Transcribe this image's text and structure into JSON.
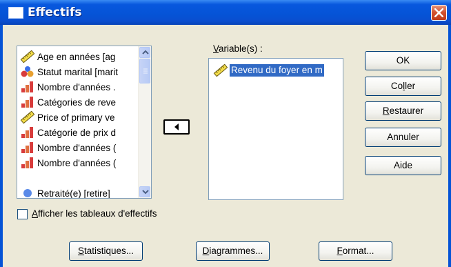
{
  "window": {
    "title": "Effectifs"
  },
  "source_list": {
    "items": [
      {
        "label": "Age en années [ag",
        "icon": "scale-ruler-icon"
      },
      {
        "label": "Statut marital [marit",
        "icon": "nominal-people-icon"
      },
      {
        "label": "Nombre d'années .",
        "icon": "ordinal-bars-icon"
      },
      {
        "label": "Catégories de reve",
        "icon": "ordinal-bars-icon"
      },
      {
        "label": "Price of primary ve",
        "icon": "scale-ruler-icon"
      },
      {
        "label": "Catégorie de prix d",
        "icon": "ordinal-bars-icon"
      },
      {
        "label": "Nombre d'années (",
        "icon": "ordinal-bars-icon"
      },
      {
        "label": "Nombre d'années (",
        "icon": "ordinal-bars-icon"
      },
      {
        "label": "Retraité(e) [retire]",
        "icon": "nominal-circle-icon"
      }
    ]
  },
  "target": {
    "label_prefix": "V",
    "label_rest": "ariable(s) :",
    "items": [
      {
        "label": "Revenu du foyer en m",
        "icon": "scale-ruler-icon"
      }
    ]
  },
  "buttons": {
    "ok": "OK",
    "paste": {
      "pre": "Co",
      "u": "l",
      "post": "ler"
    },
    "reset": {
      "pre": "",
      "u": "R",
      "post": "estaurer"
    },
    "cancel": "Annuler",
    "help": "Aide",
    "statistics": {
      "pre": "",
      "u": "S",
      "post": "tatistiques..."
    },
    "charts": {
      "pre": "",
      "u": "D",
      "post": "iagrammes..."
    },
    "format": {
      "pre": "",
      "u": "F",
      "post": "ormat..."
    }
  },
  "checkbox": {
    "checked": false,
    "u": "A",
    "rest": "fficher les tableaux d'effectifs"
  },
  "colors": {
    "title_bar": "#0553d6",
    "dialog_bg": "#ECE9D8",
    "selection": "#316ac5",
    "close_button": "#d2502e"
  }
}
